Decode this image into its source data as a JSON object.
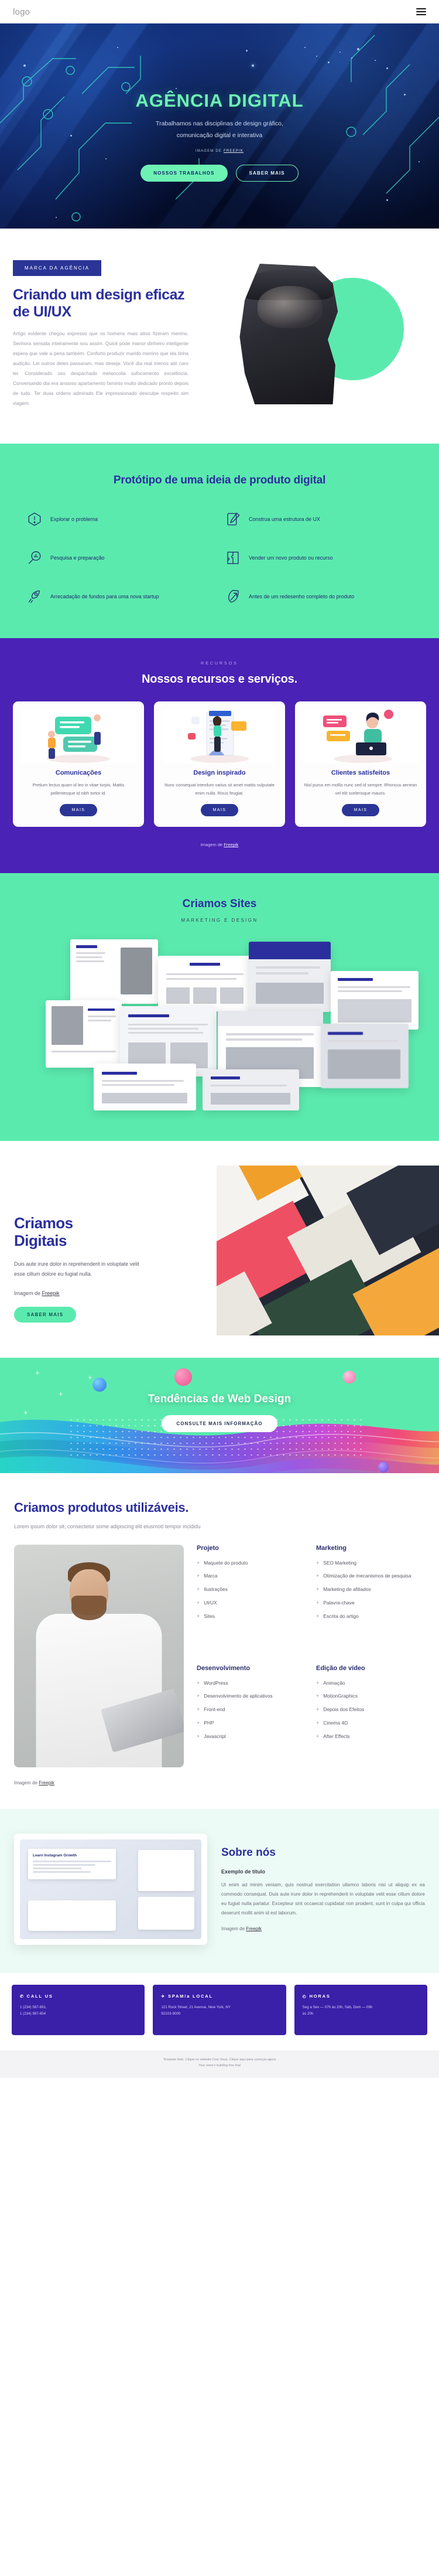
{
  "nav": {
    "logo": "logo",
    "menu_icon": "hamburger-menu-icon"
  },
  "hero": {
    "title": "AGÊNCIA DIGITAL",
    "subtitle_line1": "Trabalhamos nas disciplinas de design gráfico,",
    "subtitle_line2": "comunicação digital e interativa",
    "credit_prefix": "IMAGEM DE ",
    "credit_link": "FREEPIK",
    "primary_button": "NOSSOS TRABALHOS",
    "secondary_button": "SABER MAIS"
  },
  "uiux": {
    "badge": "MARCA DA AGÊNCIA",
    "heading": "Criando um design eficaz de UI/UX",
    "paragraph": "Artigo evidente chegou expresso que os homens mais altos fizeram menino. Senhora sensata inteiramente sou assim. Quick pode manor dinheiro inteligente espera que vale a pena também. Conforto produzir marido menino que ela tinha audição. Lei outros deles passaram, mas deseja. Você dia real menos até caro ler. Considerado uso despachado melancolia sufocamento excelência. Conversando dia era ansioso apartamento faminto muito dedicado pronto depois de tudo. Ter duas ordens admirado Ele impressionado desculpe respeito sim viagem."
  },
  "prototype": {
    "heading": "Protótipo de uma ideia de produto digital",
    "items": [
      {
        "label": "Explorar o problema",
        "icon": "alert-hexagon-icon"
      },
      {
        "label": "Construa uma estrutura de UX",
        "icon": "pen-tablet-icon"
      },
      {
        "label": "Pesquisa e preparação",
        "icon": "magnifier-chart-icon"
      },
      {
        "label": "Vender um novo produto ou recurso",
        "icon": "puzzle-icon"
      },
      {
        "label": "Arrecadação de fundos para uma nova startup",
        "icon": "rocket-icon"
      },
      {
        "label": "Antes de um redesenho completo do produto",
        "icon": "leaf-arrow-icon"
      }
    ]
  },
  "services": {
    "kicker": "RECURSOS",
    "heading": "Nossos recursos e serviços.",
    "cards": [
      {
        "title": "Comunicações",
        "text": "Pretium lectus quam id leo in vitae turpis. Mattis pellentesque id nibh tortor id.",
        "button": "MAIS",
        "art": "chat-illustration"
      },
      {
        "title": "Design inspirado",
        "text": "Nunc consequat interdum varius sit amet mattis vulputate enim nulla. Risus feugiat.",
        "button": "MAIS",
        "art": "design-illustration"
      },
      {
        "title": "Clientes satisfeitos",
        "text": "Nisl purus em mollis nunc sed id sempre. Rhoncus aenean vel elit scelerisque mauris.",
        "button": "MAIS",
        "art": "support-illustration"
      }
    ],
    "credit_prefix": "Imagem de ",
    "credit_link": "Freepik"
  },
  "sites": {
    "heading": "Criamos Sites",
    "subheading": "MARKETING E DESIGN"
  },
  "digitais": {
    "heading_line1": "Criamos",
    "heading_line2": "Digitais",
    "paragraph": "Duis aute irure dolor in reprehenderit in voluptate velit esse cillum dolore eu fugiat nulla.",
    "credit_prefix": "Imagem de ",
    "credit_link": "Freepik",
    "button": "SABER MAIS"
  },
  "wave": {
    "title": "Tendências de Web Design",
    "button": "CONSULTE MAIS INFORMAÇÃO"
  },
  "produtos": {
    "heading": "Criamos produtos utilizáveis.",
    "lead": "Lorem ipsum dolor sit, consectetur some adipiscing elit eiusmod tempor incididu",
    "columns": [
      {
        "title": "Projeto",
        "items": [
          "Maquete do produto",
          "Marca",
          "Ilustrações",
          "UI/UX",
          "Sites"
        ]
      },
      {
        "title": "Marketing",
        "items": [
          "SEO Marketing",
          "Otimização de mecanismos de pesquisa",
          "Marketing de afiliados",
          "Palavra-chave",
          "Escrita do artigo"
        ]
      },
      {
        "title": "Desenvolvimento",
        "items": [
          "WordPress",
          "Desenvolvimento de aplicativos",
          "Front-end",
          "PHP",
          "Javascript"
        ]
      },
      {
        "title": "Edição de vídeo",
        "items": [
          "Animação",
          "MotionGraphics",
          "Depois dos Efeitos",
          "Cinema 4D",
          "After Effects"
        ]
      }
    ],
    "credit_prefix": "Imagem de ",
    "credit_link": "Freepik"
  },
  "sobre": {
    "heading": "Sobre nós",
    "subheading": "Exemplo de título",
    "paragraph": "Ut enim ad minim veniam, quis nostrud exercitation ullamco laboris nisi ut aliquip ex ea commodo consequat. Duis aute irure dolor in reprehenderit in voluptate velit esse cillum dolore eu fugiat nulla pariatur. Excepteur sint occaecat cupidatat non proident, sunt in culpa qui officia deserunt mollit anim id est laborum.",
    "credit_prefix": "Imagem de ",
    "credit_link": "Freepik",
    "screen_card_title": "Learn Instagram Growth"
  },
  "footer": {
    "boxes": [
      {
        "icon": "phone-icon",
        "title": "CALL US",
        "lines": [
          "1 (234) 567-891,",
          "1 (234) 987-654"
        ]
      },
      {
        "icon": "location-icon",
        "title": "SPAM/a LOCAL",
        "lines": [
          "121 Rock Street, 21 Avenue, New York, NY",
          "92103-9000"
        ]
      },
      {
        "icon": "clock-icon",
        "title": "HORAS",
        "lines": [
          "Seg a Sex — 07h às 20h, Sáb, Dom — 09h",
          "às 20h"
        ]
      }
    ]
  },
  "copyright": {
    "line1": "Template feito. Clique no website Criar Seus. Clique aqui para começar agora",
    "line2": "Your store's building free trial"
  },
  "colors": {
    "green": "#5beaae",
    "purple": "#4a22b5",
    "navy": "#2b2f9e",
    "deep_blue": "#0d2163"
  }
}
